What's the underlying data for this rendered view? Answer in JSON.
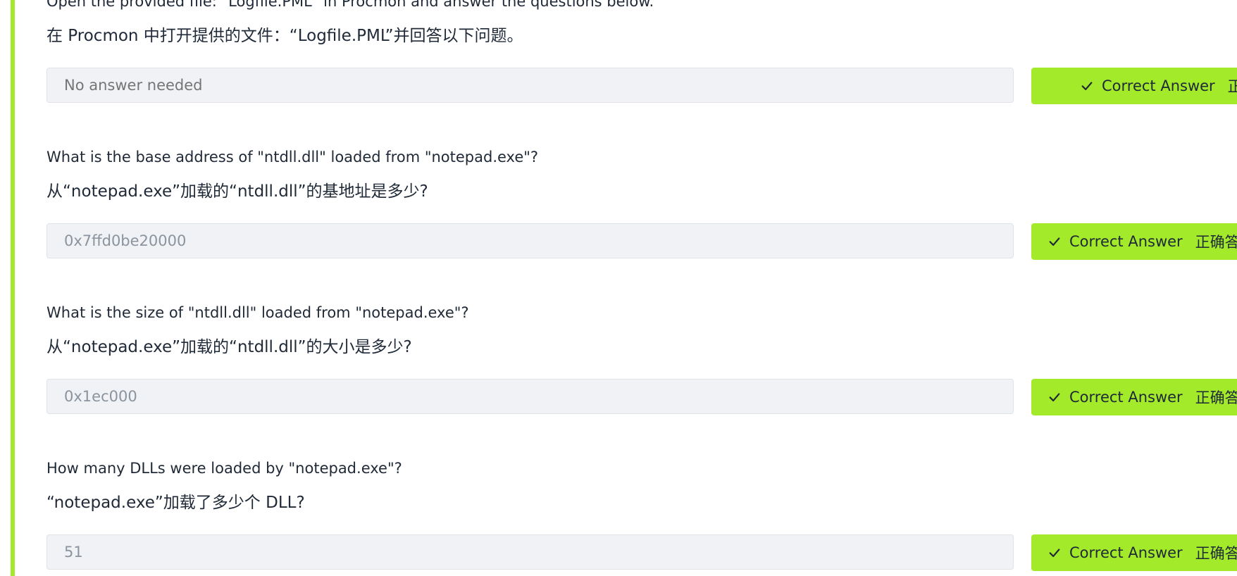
{
  "questions": [
    {
      "question_en": "Open the provided file: \"Logfile.PML\" in Procmon and answer the questions below.",
      "question_zh": "在 Procmon 中打开提供的文件：“Logfile.PML”并回答以下问题。",
      "answer_placeholder": "No answer needed",
      "button_en": "Correct Answer",
      "button_zh": "正"
    },
    {
      "question_en": "What is the base address of \"ntdll.dll\" loaded from \"notepad.exe\"?",
      "question_zh": "从“notepad.exe”加载的“ntdll.dll”的基地址是多少?",
      "answer_value": "0x7ffd0be20000",
      "button_en": "Correct Answer",
      "button_zh": "正确答"
    },
    {
      "question_en": "What is the size of \"ntdll.dll\" loaded from \"notepad.exe\"?",
      "question_zh": "从“notepad.exe”加载的“ntdll.dll”的大小是多少?",
      "answer_value": "0x1ec000",
      "button_en": "Correct Answer",
      "button_zh": "正确答"
    },
    {
      "question_en": "How many DLLs were loaded by \"notepad.exe\"?",
      "question_zh": "“notepad.exe”加载了多少个 DLL?",
      "answer_value": "51",
      "button_en": "Correct Answer",
      "button_zh": "正确答"
    }
  ],
  "icons": {
    "correct_button_icon": "check-icon"
  },
  "colors": {
    "accent": "#a3ea2a",
    "input_background": "#f0f2f5",
    "input_text": "#8b949e",
    "text": "#1f2937"
  }
}
